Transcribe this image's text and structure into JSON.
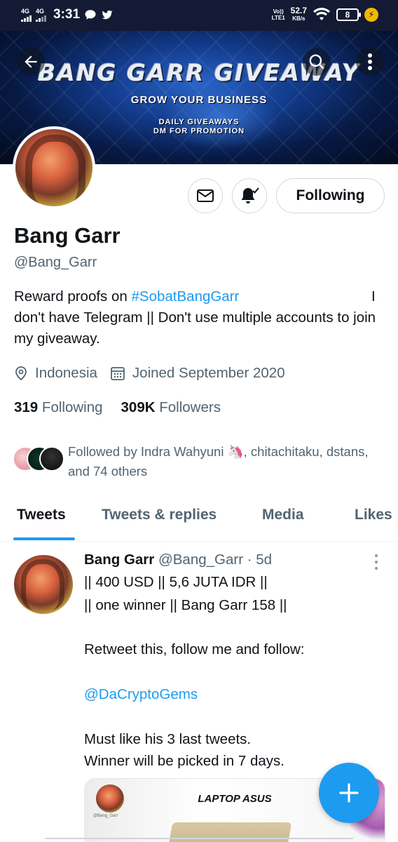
{
  "status_bar": {
    "network1": "4G",
    "network2": "4G",
    "time": "3:31",
    "volte_top": "Vo))",
    "volte_bottom": "LTE1",
    "speed_value": "52.7",
    "speed_unit": "KB/s",
    "battery": "8"
  },
  "banner": {
    "title": "BANG GARR GIVEAWAY",
    "subtitle": "GROW YOUR BUSINESS",
    "line1": "DAILY GIVEAWAYS",
    "line2": "DM FOR PROMOTION"
  },
  "profile": {
    "name": "Bang Garr",
    "handle": "@Bang_Garr",
    "bio_prefix": "Reward proofs on ",
    "bio_hashtag": "#SobatBangGarr",
    "bio_pipe": "I",
    "bio_rest": "don't have Telegram || Don't use multiple accounts to join my giveaway.",
    "location": "Indonesia",
    "joined": "Joined September 2020",
    "following_count": "319",
    "following_label": "Following",
    "followers_count": "309K",
    "followers_label": "Followers",
    "followed_by": "Followed by Indra Wahyuni 🦄, chitachitaku, dstans, and 74 others"
  },
  "actions": {
    "follow_button": "Following"
  },
  "tabs": [
    {
      "label": "Tweets",
      "active": true
    },
    {
      "label": "Tweets & replies",
      "active": false
    },
    {
      "label": "Media",
      "active": false
    },
    {
      "label": "Likes",
      "active": false
    }
  ],
  "tweet": {
    "name": "Bang Garr",
    "handle": "@Bang_Garr",
    "time": "· 5d",
    "lines": [
      "|| 400 USD || 5,6 JUTA IDR ||",
      "|| one winner || Bang Garr 158 ||",
      "Retweet this, follow me and follow:",
      "@DaCryptoGems",
      "Must like his 3 last tweets.",
      "Winner will be picked in 7 days."
    ],
    "media_title": "LAPTOP ASUS",
    "media_handle": "@Bang_Garr"
  },
  "colors": {
    "accent": "#1d9bf0",
    "text_primary": "#0f1419",
    "text_secondary": "#536471",
    "status_bar_bg": "#141a33"
  },
  "icons": [
    "back-arrow-icon",
    "search-icon",
    "more-vertical-icon",
    "mail-icon",
    "bell-icon",
    "location-icon",
    "calendar-icon",
    "compose-plus-icon"
  ]
}
